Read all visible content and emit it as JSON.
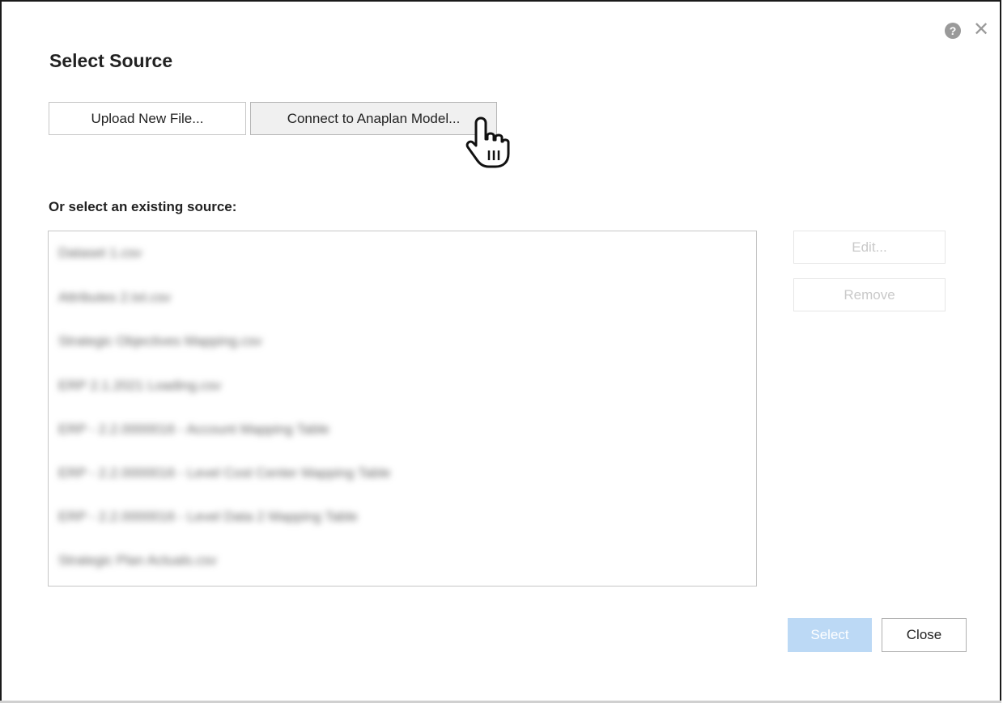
{
  "dialog": {
    "title": "Select Source",
    "help_glyph": "?",
    "close_glyph": "✕"
  },
  "actions": {
    "upload_label": "Upload New File...",
    "connect_label": "Connect to Anaplan Model..."
  },
  "existing": {
    "label": "Or select an existing source:",
    "items": [
      "Dataset 1.csv",
      "Attributes 2.txt.csv",
      "Strategic Objectives Mapping.csv",
      "ERP 2.1.2021 Loading.csv",
      "ERP - 2.2.0000016 - Account Mapping Table",
      "ERP - 2.2.0000016 - Level Cost Center Mapping Table",
      "ERP - 2.2.0000016 - Level Data 2 Mapping Table",
      "Strategic Plan Actuals.csv"
    ]
  },
  "side_buttons": {
    "edit_label": "Edit...",
    "remove_label": "Remove"
  },
  "footer": {
    "select_label": "Select",
    "close_label": "Close"
  },
  "icons": {
    "help": "question-circle-icon",
    "close": "close-icon",
    "cursor": "hand-pointer-cursor-icon"
  },
  "colors": {
    "select_disabled_bg": "#bcd9f5",
    "icon_gray": "#9a9a9a",
    "border": "#c6c6c6"
  }
}
